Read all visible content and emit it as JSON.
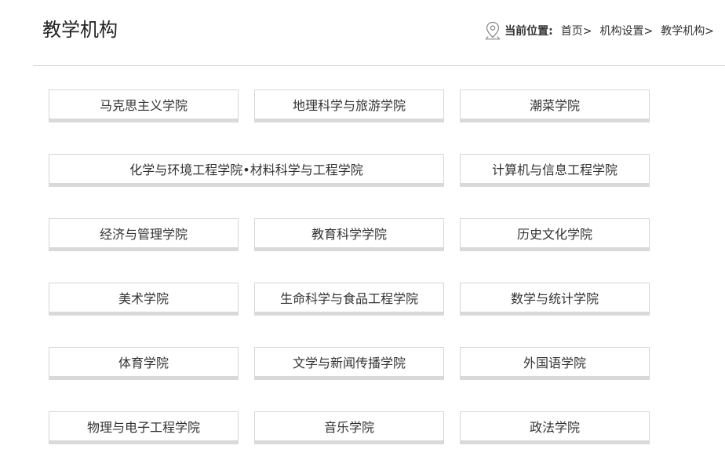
{
  "header": {
    "title": "教学机构"
  },
  "breadcrumb": {
    "icon": "location-pin-icon",
    "label": "当前位置:",
    "items": [
      "首页>",
      "机构设置>",
      "教学机构>"
    ]
  },
  "colleges": [
    "马克思主义学院",
    "地理科学与旅游学院",
    "潮菜学院",
    "化学与环境工程学院•材料科学与工程学院",
    "计算机与信息工程学院",
    "经济与管理学院",
    "教育科学学院",
    "历史文化学院",
    "美术学院",
    "生命科学与食品工程学院",
    "数学与统计学院",
    "体育学院",
    "文学与新闻传播学院",
    "外国语学院",
    "物理与电子工程学院",
    "音乐学院",
    "政法学院"
  ]
}
